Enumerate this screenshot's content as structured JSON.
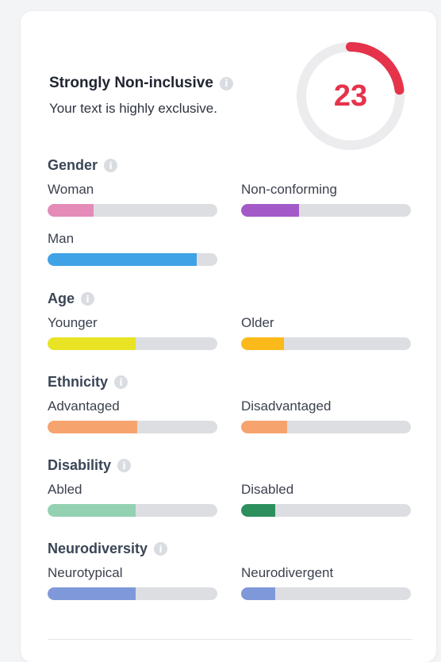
{
  "score": {
    "title": "Strongly Non-inclusive",
    "subtitle": "Your text is highly exclusive.",
    "value": "23",
    "arc_fraction": 0.23,
    "arc_color": "#e5334b",
    "track_color": "#ececee"
  },
  "sections": [
    {
      "title": "Gender",
      "info_icon": "info-icon",
      "metrics": [
        {
          "label": "Woman",
          "level": 0.27,
          "color": "#e48bb8"
        },
        {
          "label": "Non-conforming",
          "level": 0.34,
          "color": "#a35ac8"
        },
        {
          "label": "Man",
          "level": 0.88,
          "color": "#3fa2e6"
        }
      ]
    },
    {
      "title": "Age",
      "info_icon": "info-icon",
      "metrics": [
        {
          "label": "Younger",
          "level": 0.52,
          "color": "#e8e425"
        },
        {
          "label": "Older",
          "level": 0.25,
          "color": "#fbb91a"
        }
      ]
    },
    {
      "title": "Ethnicity",
      "info_icon": "info-icon",
      "metrics": [
        {
          "label": "Advantaged",
          "level": 0.53,
          "color": "#f7a36e"
        },
        {
          "label": "Disadvantaged",
          "level": 0.27,
          "color": "#f7a36e"
        }
      ]
    },
    {
      "title": "Disability",
      "info_icon": "info-icon",
      "metrics": [
        {
          "label": "Abled",
          "level": 0.52,
          "color": "#94d1b3"
        },
        {
          "label": "Disabled",
          "level": 0.2,
          "color": "#2e8f5e"
        }
      ]
    },
    {
      "title": "Neurodiversity",
      "info_icon": "info-icon",
      "metrics": [
        {
          "label": "Neurotypical",
          "level": 0.52,
          "color": "#7f98d9"
        },
        {
          "label": "Neurodivergent",
          "level": 0.2,
          "color": "#7f98d9"
        }
      ]
    }
  ]
}
